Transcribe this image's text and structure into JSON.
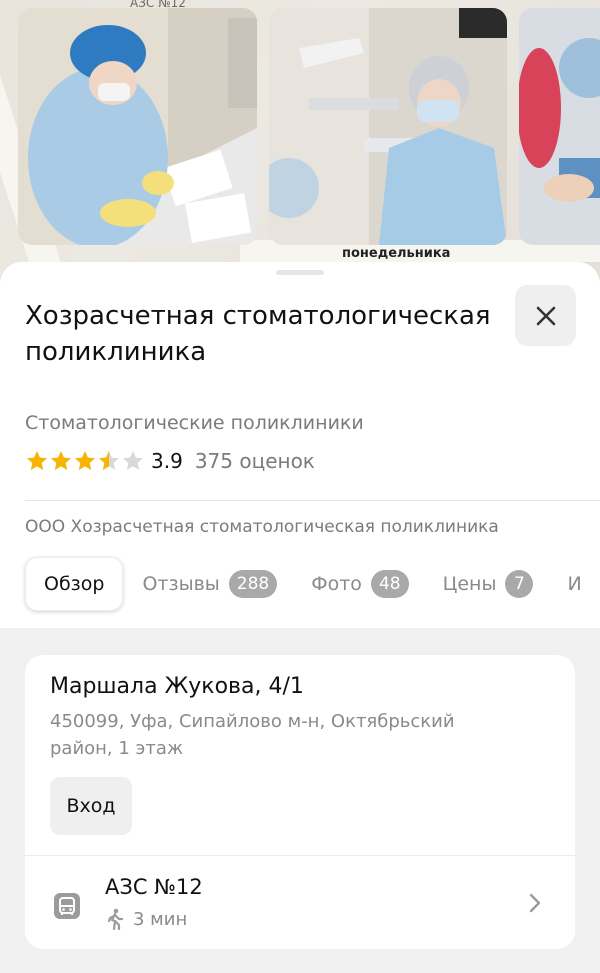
{
  "map": {
    "labels": [
      "АЗС №12",
      "понедельника"
    ],
    "photos": [
      {
        "icon": "photo-dentist-writing"
      },
      {
        "icon": "photo-dentist-in-office"
      },
      {
        "icon": "photo-dental-procedure"
      }
    ]
  },
  "place": {
    "title": "Хозрасчетная стоматологическая поликлиника",
    "category": "Стоматологические поликлиники",
    "rating_value": "3.9",
    "rating_count": "375 оценок",
    "rating_stars": 3.5,
    "legal_name": "ООО Хозрасчетная стоматологическая поликлиника"
  },
  "tabs": [
    {
      "label": "Обзор",
      "active": true
    },
    {
      "label": "Отзывы",
      "badge": "288"
    },
    {
      "label": "Фото",
      "badge": "48"
    },
    {
      "label": "Цены",
      "badge": "7"
    },
    {
      "label": "И"
    }
  ],
  "address": {
    "main": "Маршала Жукова, 4/1",
    "sub": "450099, Уфа, Сипайлово м-н, Октябрьский район, 1 этаж",
    "entrance_label": "Вход"
  },
  "transit": {
    "stop_name": "АЗС №12",
    "walk_time": "3 мин",
    "icon": "bus-stop-icon"
  },
  "colors": {
    "star_filled": "#f5b400",
    "star_empty": "#d9d9d9",
    "badge": "#a9a9a9",
    "secondary_text": "#7b7b7b"
  }
}
